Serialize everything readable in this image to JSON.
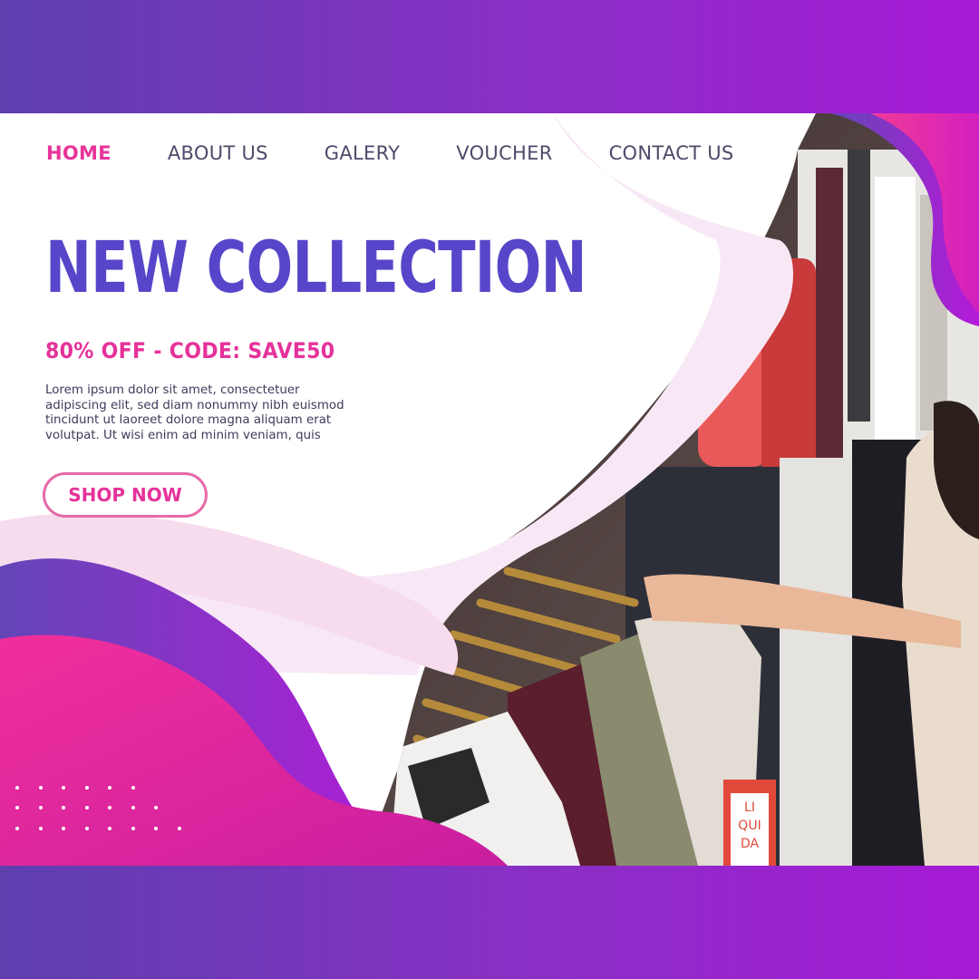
{
  "nav": {
    "items": [
      {
        "label": "HOME",
        "active": true
      },
      {
        "label": "ABOUT US",
        "active": false
      },
      {
        "label": "GALERY",
        "active": false
      },
      {
        "label": "VOUCHER",
        "active": false
      },
      {
        "label": "CONTACT US",
        "active": false
      }
    ]
  },
  "hero": {
    "title": "NEW COLLECTION",
    "promo": "80% OFF - CODE: SAVE50",
    "description": "Lorem ipsum dolor sit amet, consectetuer adipiscing elit, sed diam nonummy nibh euismod tincidunt ut laoreet dolore magna aliquam erat volutpat. Ut wisi enim ad minim veniam, quis",
    "cta_label": "SHOP NOW"
  },
  "photo": {
    "tag_text": "LI QUI DA"
  },
  "colors": {
    "band_start": "#5d3fae",
    "band_end": "#a61ad6",
    "accent_pink": "#e5329a",
    "title_purple": "#5746c9"
  }
}
